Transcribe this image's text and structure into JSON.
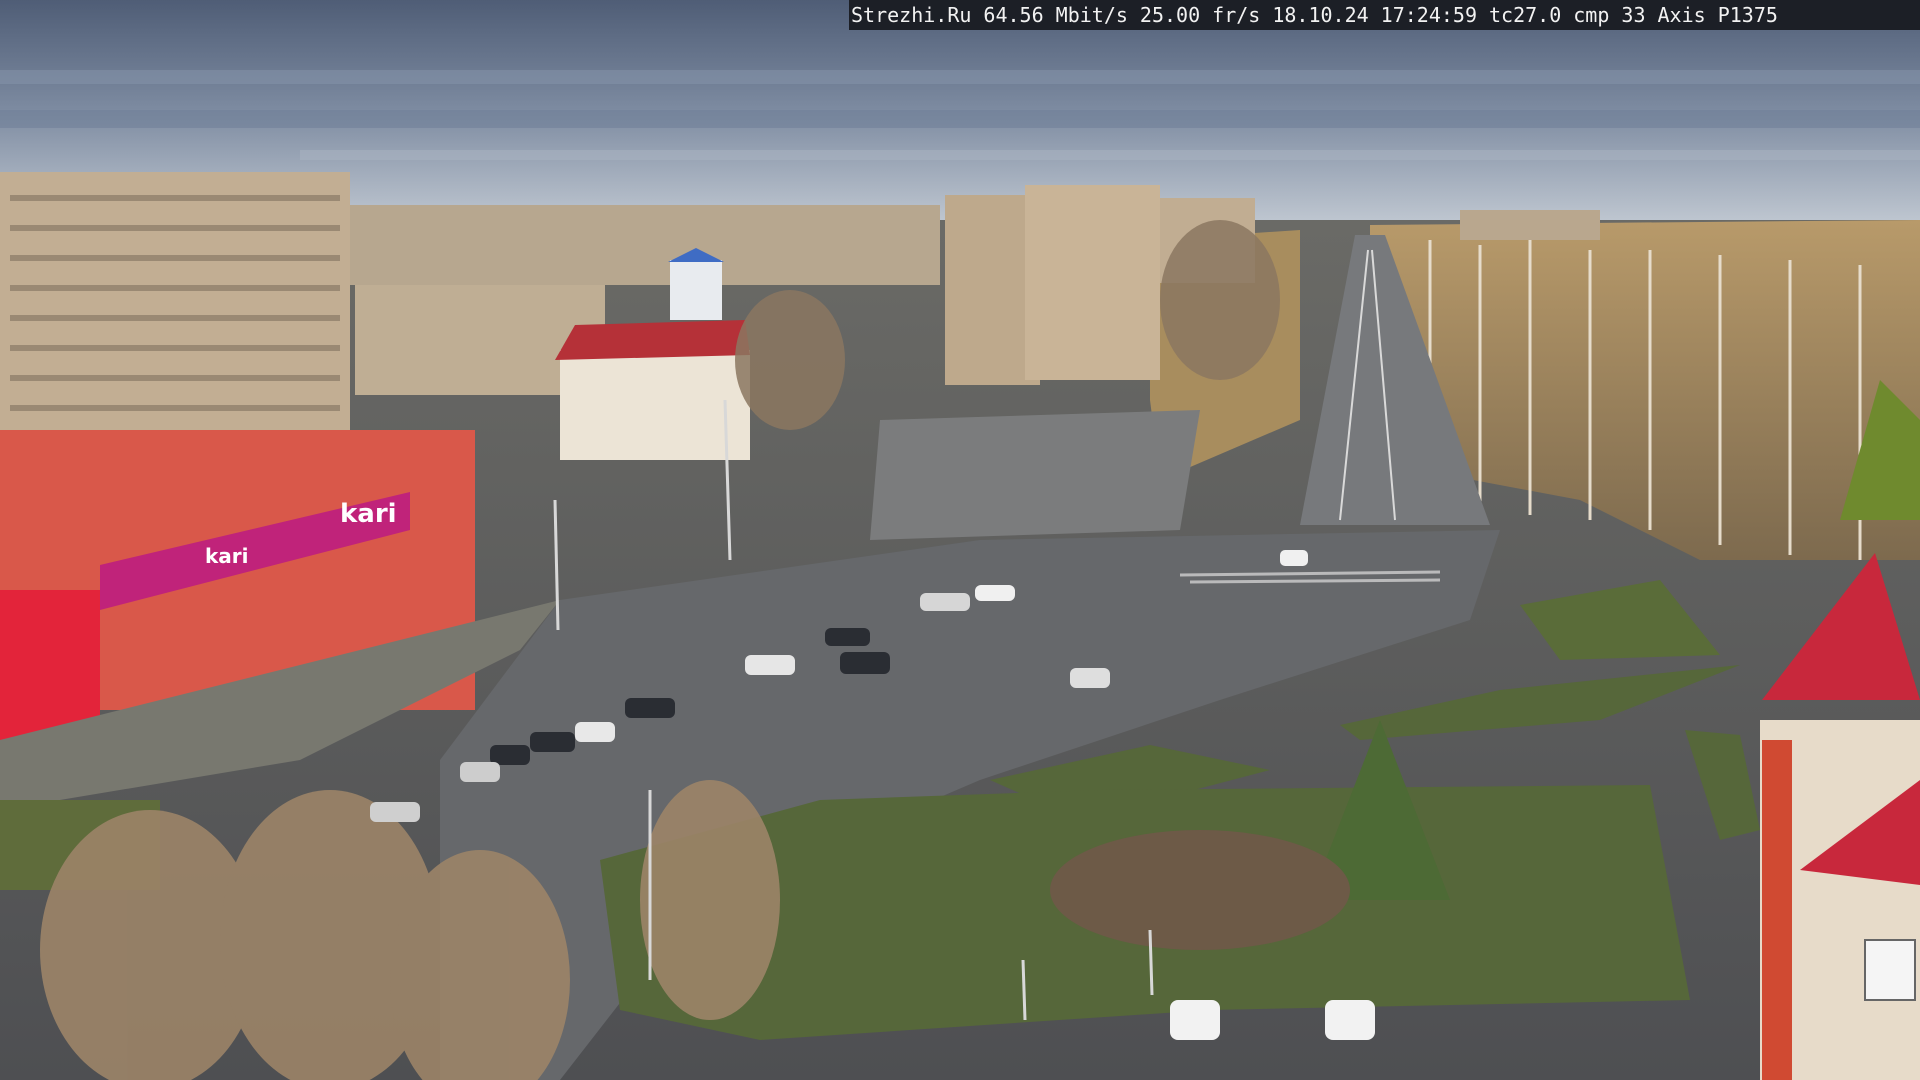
{
  "overlay": {
    "site": "Strezhi.Ru",
    "bitrate": "64.56 Mbit/s",
    "framerate": "25.00 fr/s",
    "date": "18.10.24",
    "time": "17:24:59",
    "tc": "tc27.0",
    "cmp": "cmp 33",
    "camera": "Axis P1375"
  },
  "signs": {
    "store_brand": "kari",
    "store_brand_repeat": "kari"
  },
  "colors": {
    "sky_top": "#55647c",
    "sky_bottom": "#c3ccd6",
    "asphalt": "#5b5d61",
    "grass": "#56673a",
    "store_red": "#d9584a",
    "store_magenta": "#c0237a",
    "tower_red": "#c8283c"
  }
}
